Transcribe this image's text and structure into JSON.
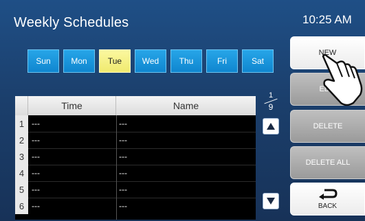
{
  "header": {
    "title": "Weekly Schedules",
    "time": "10:25 AM"
  },
  "days": {
    "selected": "Tue",
    "items": [
      {
        "label": "Sun"
      },
      {
        "label": "Mon"
      },
      {
        "label": "Tue"
      },
      {
        "label": "Wed"
      },
      {
        "label": "Thu"
      },
      {
        "label": "Fri"
      },
      {
        "label": "Sat"
      }
    ]
  },
  "table": {
    "headers": {
      "time": "Time",
      "name": "Name"
    },
    "rows": [
      {
        "num": "1",
        "time": "---",
        "name": "---"
      },
      {
        "num": "2",
        "time": "---",
        "name": "---"
      },
      {
        "num": "3",
        "time": "---",
        "name": "---"
      },
      {
        "num": "4",
        "time": "---",
        "name": "---"
      },
      {
        "num": "5",
        "time": "---",
        "name": "---"
      },
      {
        "num": "6",
        "time": "---",
        "name": "---"
      }
    ]
  },
  "pagination": {
    "current": "1",
    "total": "9"
  },
  "actions": {
    "new": "NEW",
    "edit": "EDIT",
    "delete": "DELETE",
    "delete_all": "DELETE ALL",
    "back": "BACK"
  },
  "icons": {
    "up": "up-arrow-icon",
    "down": "down-arrow-icon",
    "back": "return-arrow-icon",
    "pointer": "pointing-hand-icon"
  },
  "colors": {
    "background": "#1b3f6c",
    "day_button": "#1899dd",
    "day_selected": "#f5ef7f",
    "action_disabled": "#a8a8a8",
    "action_enabled": "#ffffff"
  }
}
